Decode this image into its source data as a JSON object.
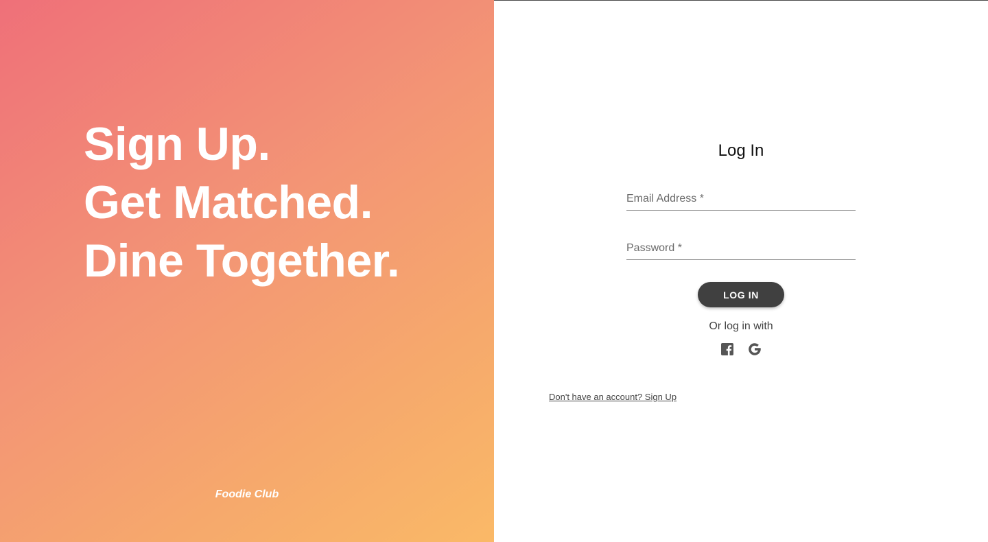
{
  "hero": {
    "headline_lines": [
      "Sign Up.",
      "Get Matched.",
      "Dine Together."
    ],
    "brand": "Foodie Club"
  },
  "login": {
    "title": "Log In",
    "email_label": "Email Address *",
    "password_label": "Password *",
    "button_label": "LOG IN",
    "or_text": "Or log in with",
    "social_icons": [
      "facebook-icon",
      "google-icon"
    ],
    "signup_link": "Don't have an account? Sign Up"
  },
  "colors": {
    "gradient_start": "#ef7079",
    "gradient_end": "#fab967",
    "button_bg": "#404040"
  }
}
